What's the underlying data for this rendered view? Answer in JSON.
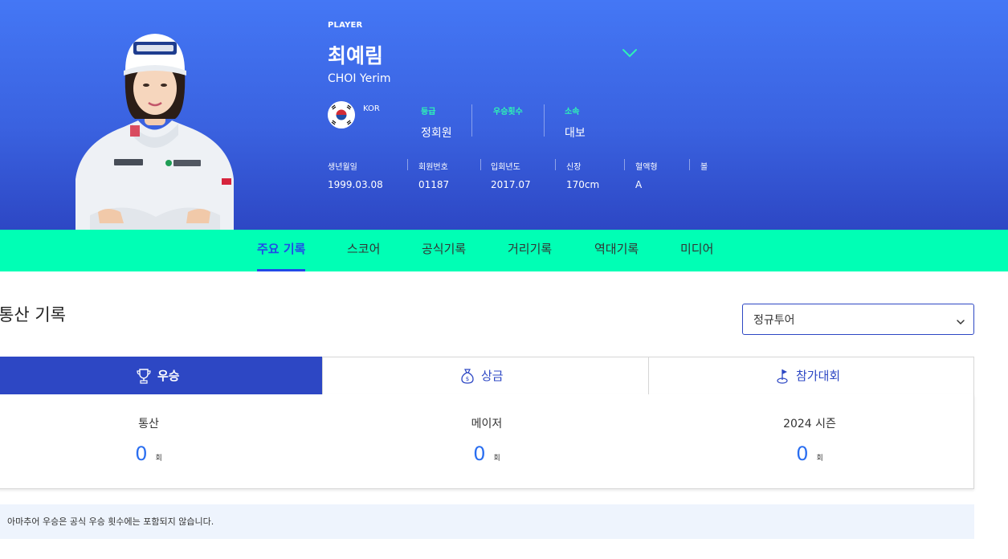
{
  "player": {
    "label": "PLAYER",
    "name_ko": "최예림",
    "name_en": "CHOI Yerim",
    "country": "KOR",
    "stats": [
      {
        "key": "등급",
        "value": "정회원"
      },
      {
        "key": "우승횟수",
        "value": ""
      },
      {
        "key": "소속",
        "value": "대보"
      }
    ],
    "info": [
      {
        "key": "생년월일",
        "value": "1999.03.08"
      },
      {
        "key": "회원번호",
        "value": "01187"
      },
      {
        "key": "입회년도",
        "value": "2017.07"
      },
      {
        "key": "신장",
        "value": "170cm"
      },
      {
        "key": "혈액형",
        "value": "A"
      },
      {
        "key": "볼",
        "value": ""
      }
    ]
  },
  "nav": {
    "tabs": [
      "주요 기록",
      "스코어",
      "공식기록",
      "거리기록",
      "역대기록",
      "미디어"
    ],
    "active": "주요 기록"
  },
  "section": {
    "title": "통산 기록",
    "select_value": "정규투어"
  },
  "record_tabs": [
    {
      "label": "우승",
      "icon": "trophy-icon",
      "active": true
    },
    {
      "label": "상금",
      "icon": "money-bag-icon",
      "active": false
    },
    {
      "label": "참가대회",
      "icon": "golf-flag-icon",
      "active": false
    }
  ],
  "records": [
    {
      "label": "통산",
      "value": "0",
      "unit": "회"
    },
    {
      "label": "메이저",
      "value": "0",
      "unit": "회"
    },
    {
      "label": "2024 시즌",
      "value": "0",
      "unit": "회"
    }
  ],
  "notice": "아마추어 우승은 공식 우승 횟수에는 포함되지 않습니다.",
  "colors": {
    "hero_top": "#4477f5",
    "hero_bottom": "#2d47c4",
    "tab_bar": "#00ffb5",
    "accent": "#2249e8",
    "stat_key": "#2ef2b6",
    "number": "#2a6ef0"
  }
}
